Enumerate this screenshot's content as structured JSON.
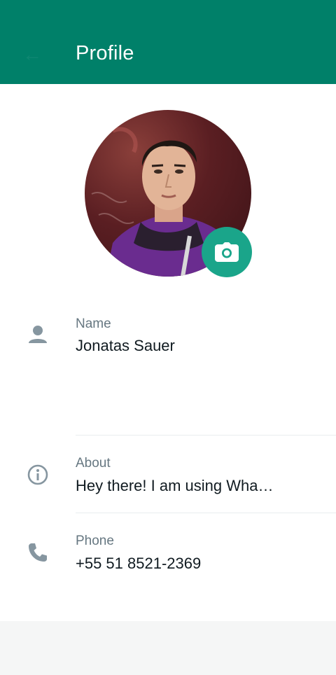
{
  "appbar": {
    "title": "Profile",
    "back_icon": "back-arrow-icon"
  },
  "avatar": {
    "icon": "camera-icon"
  },
  "fields": {
    "name": {
      "label": "Name",
      "value": "Jonatas Sauer",
      "icon": "person-icon"
    },
    "about": {
      "label": "About",
      "value": "Hey there! I am using Wha…",
      "icon": "info-icon"
    },
    "phone": {
      "label": "Phone",
      "value": "+55 51 8521-2369",
      "icon": "phone-icon"
    }
  },
  "colors": {
    "primary": "#008069",
    "accent": "#1aa58a",
    "icon": "#8696a0"
  }
}
